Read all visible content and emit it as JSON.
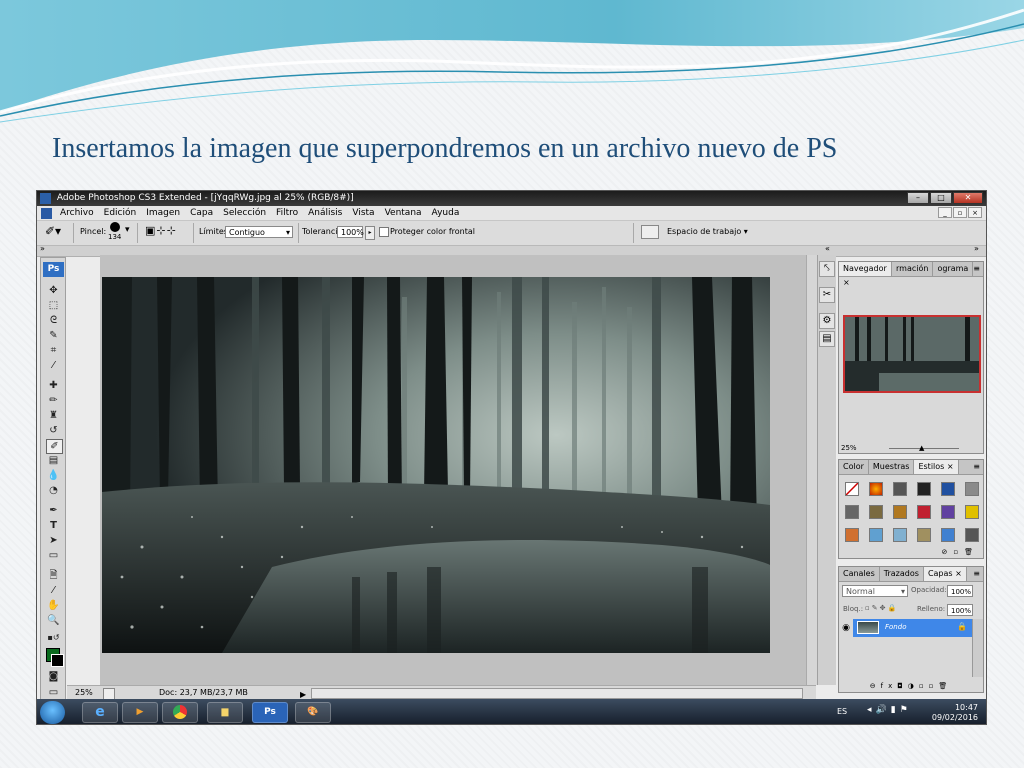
{
  "slide": {
    "title": "Insertamos  la imagen que superpondremos en un archivo nuevo de PS"
  },
  "window": {
    "title": "Adobe Photoshop CS3 Extended - [jYqqRWg.jpg al 25% (RGB/8#)]",
    "min_label": "–",
    "max_label": "□",
    "close_label": "✕"
  },
  "menu": [
    "Archivo",
    "Edición",
    "Imagen",
    "Capa",
    "Selección",
    "Filtro",
    "Análisis",
    "Vista",
    "Ventana",
    "Ayuda"
  ],
  "options": {
    "brush_label": "Pincel:",
    "brush_size": "134",
    "limits_label": "Límites:",
    "limits_value": "Contiguo",
    "tolerance_label": "Tolerancia:",
    "tolerance_value": "100%",
    "protect_label": "Proteger color frontal",
    "workspace_label": "Espacio de trabajo"
  },
  "toolbox": {
    "logo": "Ps",
    "tools": [
      "move-icon",
      "marquee-icon",
      "lasso-icon",
      "quick-select-icon",
      "crop-icon",
      "eyedropper-icon",
      "healing-icon",
      "brush-icon",
      "stamp-icon",
      "history-brush-icon",
      "background-eraser-icon",
      "gradient-icon",
      "blur-icon",
      "dodge-icon",
      "pen-icon",
      "type-icon",
      "path-select-icon",
      "shape-icon",
      "notes-icon",
      "eyedropper2-icon",
      "hand-icon",
      "zoom-icon"
    ],
    "foreground_color": "#0a6b1e",
    "background_color": "#000000"
  },
  "status": {
    "zoom": "25%",
    "doc": "Doc: 23,7 MB/23,7 MB"
  },
  "navigator": {
    "tabs": [
      "Navegador",
      "Información",
      "Histograma"
    ],
    "tab_texts": [
      "Navegador ×",
      "rmación",
      "ograma"
    ],
    "zoom": "25%"
  },
  "color_panel": {
    "tabs": [
      "Color",
      "Muestras",
      "Estilos ×"
    ]
  },
  "layers": {
    "tabs": [
      "Canales",
      "Trazados",
      "Capas ×"
    ],
    "blend_mode": "Normal",
    "opacity_label": "Opacidad:",
    "opacity_value": "100%",
    "lock_label": "Bloq.:",
    "fill_label": "Relleno:",
    "fill_value": "100%",
    "layer_name": "Fondo"
  },
  "taskbar": {
    "ps_label": "Ps",
    "lang": "ES",
    "time": "10:47",
    "date": "09/02/2016"
  }
}
